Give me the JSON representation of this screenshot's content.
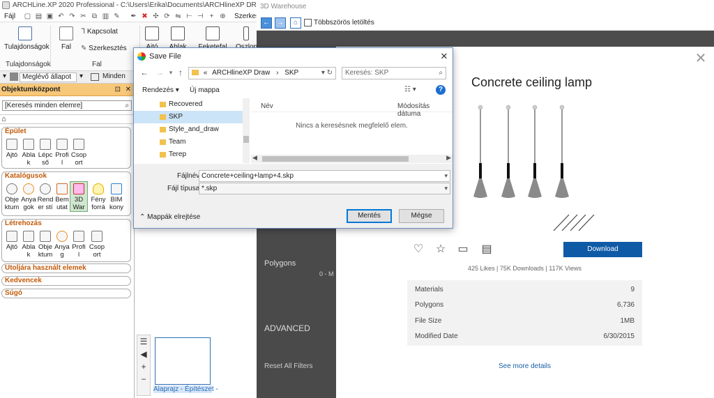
{
  "arch": {
    "title": "ARCHLine.XP 2020  Professional - C:\\Users\\Erika\\Documents\\ARCHlineXP DRAW\\Docume",
    "menu_file": "Fájl",
    "menu_edit": "Szerkesz",
    "ribbon": {
      "properties": "Tulajdonságok",
      "wall": "Fal",
      "connection": "Kapcsolat",
      "edit": "Szerkesztés",
      "door": "Ajtó",
      "window": "Ablak",
      "elevation": "Feketefal",
      "column": "Oszlop",
      "group_properties": "Tulajdonságok",
      "group_wall": "Fal"
    },
    "toolbar2": {
      "state_dropdown": "Meglévő állapot",
      "all_dropdown": "Minden"
    },
    "obj_panel": {
      "title": "Objektumközpont",
      "search": "[Keresés minden elemre]",
      "groups": {
        "building": {
          "title": "Épület",
          "items": [
            "Ajtó",
            "Abla k",
            "Lépc ső",
            "Profi l",
            "Csop ort"
          ]
        },
        "catalogs": {
          "title": "Katalógusok",
          "items": [
            "Obje ktum",
            "Anya gok",
            "Rend er stí",
            "Bem utat",
            "3D War",
            "Fény forrá",
            "BIM kony"
          ]
        },
        "create": {
          "title": "Létrehozás",
          "items": [
            "Ajtó",
            "Abla k",
            "Obje ktum",
            "Anya g",
            "Profi l",
            "Csop ort"
          ]
        },
        "recent": "Utoljára használt elemek",
        "favorites": "Kedvencek",
        "help": "Súgó"
      }
    },
    "layout_tab": "Alaprajz - Építészet -"
  },
  "warehouse": {
    "window_title": "3D Warehouse",
    "multi_download_label": "Többszörös letöltés",
    "bg_polygons": "Polygons",
    "bg_polygons_range": "0 - M",
    "bg_advanced": "ADVANCED",
    "bg_reset": "Reset All Filters",
    "model": {
      "title": "Concrete ceiling lamp",
      "download_label": "Download",
      "stats": "425 Likes  |  75K Downloads  |  117K Views",
      "details": [
        {
          "key": "Materials",
          "value": "9"
        },
        {
          "key": "Polygons",
          "value": "6,736"
        },
        {
          "key": "File Size",
          "value": "1MB"
        },
        {
          "key": "Modified Date",
          "value": "6/30/2015"
        }
      ],
      "see_more": "See more details"
    }
  },
  "dialog": {
    "title": "Save File",
    "path": [
      "ARCHlineXP Draw",
      "SKP"
    ],
    "path_prefix": "«",
    "search_placeholder": "Keresés: SKP",
    "organize": "Rendezés ▾",
    "new_folder": "Új mappa",
    "tree": [
      "Recovered",
      "SKP",
      "Style_and_draw",
      "Team",
      "Terep"
    ],
    "col_name": "Név",
    "col_modified": "Módosítás dátuma",
    "empty_message": "Nincs a keresésnek megfelelő elem.",
    "filename_label": "Fájlnév:",
    "filename_value": "Concrete+ceiling+lamp+4.skp",
    "filetype_label": "Fájl típusa:",
    "filetype_value": "*.skp",
    "save_button": "Mentés",
    "cancel_button": "Mégse",
    "hide_folders": "Mappák elrejtése"
  }
}
